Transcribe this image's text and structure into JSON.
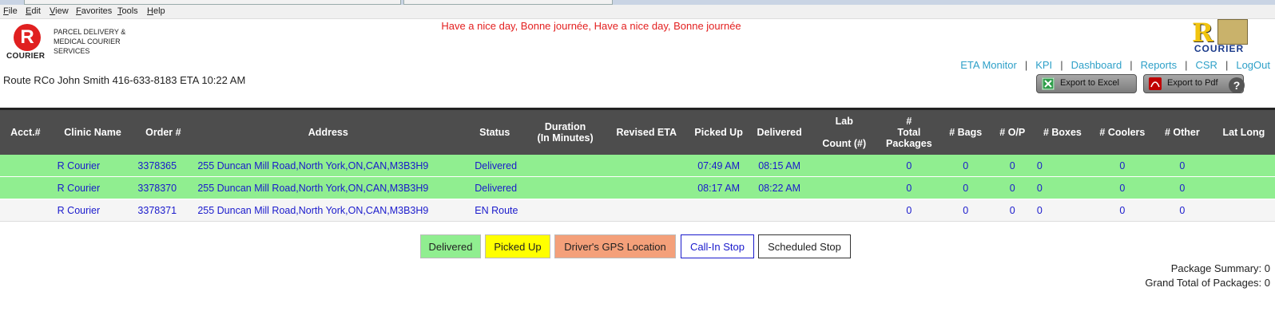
{
  "menu": [
    "File",
    "Edit",
    "View",
    "Favorites",
    "Tools",
    "Help"
  ],
  "brand": {
    "logo_letter": "R",
    "logo_word": "COURIER",
    "tagline": "PARCEL DELIVERY & MEDICAL COURIER SERVICES",
    "corner_letter": "R",
    "corner_word": "COURIER"
  },
  "greeting": "Have a nice day, Bonne journée, Have a nice day, Bonne journée",
  "route_info": "Route RCo John Smith 416-633-8183 ETA 10:22 AM",
  "nav": {
    "eta_monitor": "ETA Monitor",
    "kpi": "KPI",
    "dashboard": "Dashboard",
    "reports": "Reports",
    "csr": "CSR",
    "logout": "LogOut",
    "separator": "|"
  },
  "buttons": {
    "export_excel": "Export to Excel",
    "export_pdf": "Export to Pdf",
    "help": "?"
  },
  "table": {
    "headers": {
      "acct": "Acct.#",
      "clinic": "Clinic Name",
      "order": "Order #",
      "address": "Address",
      "status": "Status",
      "duration_1": "Duration",
      "duration_2": "(In Minutes)",
      "revised_eta": "Revised ETA",
      "picked_up": "Picked Up",
      "delivered": "Delivered",
      "lab_1": "Lab",
      "lab_2": "Count (#)",
      "total_1": "#",
      "total_2": "Total",
      "total_3": "Packages",
      "bags": "# Bags",
      "op": "# O/P",
      "boxes": "# Boxes",
      "coolers": "# Coolers",
      "other": "# Other",
      "latlong": "Lat Long"
    },
    "rows": [
      {
        "acct": "",
        "clinic": "R Courier",
        "order": "3378365",
        "address": "255 Duncan Mill Road,North York,ON,CAN,M3B3H9",
        "status": "Delivered",
        "duration": "",
        "revised_eta": "",
        "picked_up": "07:49 AM",
        "delivered": "08:15 AM",
        "lab": "",
        "total": "0",
        "bags": "0",
        "op": "0",
        "boxes": "0",
        "coolers": "0",
        "other": "0",
        "latlong": ""
      },
      {
        "acct": "",
        "clinic": "R Courier",
        "order": "3378370",
        "address": "255 Duncan Mill Road,North York,ON,CAN,M3B3H9",
        "status": "Delivered",
        "duration": "",
        "revised_eta": "",
        "picked_up": "08:17 AM",
        "delivered": "08:22 AM",
        "lab": "",
        "total": "0",
        "bags": "0",
        "op": "0",
        "boxes": "0",
        "coolers": "0",
        "other": "0",
        "latlong": ""
      },
      {
        "acct": "",
        "clinic": "R Courier",
        "order": "3378371",
        "address": "255 Duncan Mill Road,North York,ON,CAN,M3B3H9",
        "status": "EN Route",
        "duration": "",
        "revised_eta": "",
        "picked_up": "",
        "delivered": "",
        "lab": "",
        "total": "0",
        "bags": "0",
        "op": "0",
        "boxes": "0",
        "coolers": "0",
        "other": "0",
        "latlong": ""
      }
    ]
  },
  "legend": {
    "delivered": "Delivered",
    "picked_up": "Picked Up",
    "gps": "Driver's GPS Location",
    "callin": "Call-In Stop",
    "scheduled": "Scheduled Stop"
  },
  "summary": {
    "package_summary": "Package Summary: 0",
    "grand_total": "Grand Total of Packages: 0"
  },
  "colors": {
    "delivered": "#90ee90",
    "picked_up": "#ffff00",
    "gps": "#f4a07a",
    "callin_border": "#1a1acc",
    "header_bg": "#4d4d4d",
    "greeting": "#e32020",
    "nav_link": "#2ea0c8"
  }
}
